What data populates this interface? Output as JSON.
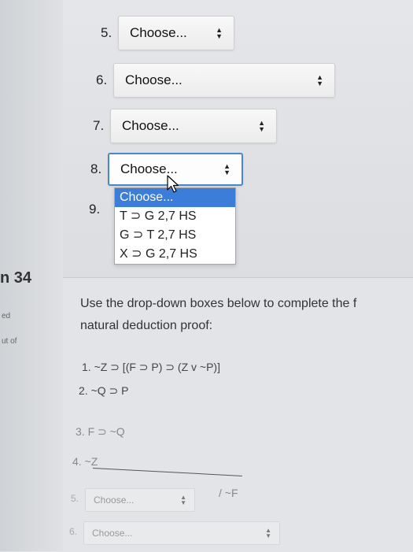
{
  "question": {
    "number_label": "n 34",
    "side_labels": [
      "ed",
      "ut of"
    ]
  },
  "selects_top": [
    {
      "num": "5.",
      "value": "Choose..."
    },
    {
      "num": "6.",
      "value": "Choose..."
    },
    {
      "num": "7.",
      "value": "Choose..."
    },
    {
      "num": "8.",
      "value": "Choose..."
    }
  ],
  "row9_num": "9.",
  "dropdown": {
    "options": [
      "Choose...",
      "T ⊃ G 2,7 HS",
      "G ⊃ T 2,7 HS",
      "X ⊃ G 2,7 HS"
    ],
    "selected_index": 0
  },
  "instructions": {
    "line1": "Use the drop-down boxes below to complete the f",
    "line2": "natural deduction proof:"
  },
  "proof": {
    "lines": [
      "1. ~Z ⊃ [(F ⊃ P) ⊃ (Z v ~P)]",
      "2. ~Q ⊃ P",
      "3. F ⊃ ~Q",
      "4. ~Z"
    ],
    "conclusion": "/ ~F"
  },
  "bottom_selects": [
    {
      "num": "5.",
      "value": "Choose..."
    },
    {
      "num": "6.",
      "value": "Choose..."
    }
  ],
  "colors": {
    "focus_border": "#4a87d0",
    "option_highlight": "#3b7dd8"
  },
  "icons": {
    "select_arrows": "up-down-arrows-icon",
    "cursor": "mouse-pointer-icon"
  }
}
